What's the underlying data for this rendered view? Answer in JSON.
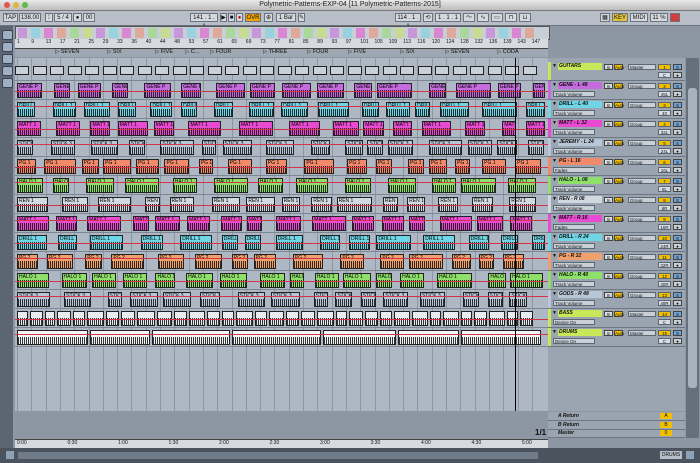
{
  "window": {
    "title": "Polymetric-Patterns-EXP-04  [11 Polymetric-Patterns-2015]"
  },
  "toolbar": {
    "tap": "TAP",
    "tempo": "138.00",
    "time_sig": "5 / 4",
    "metronome": "00",
    "position": "141 . 1 . 1",
    "ovr": "OVR",
    "quantize": "1 Bar",
    "loop_start": "114 . 1 . 1",
    "loop_length": "1 . 1 . 1",
    "key": "KEY",
    "midi": "MIDI",
    "cpu": "11 %"
  },
  "ruler": {
    "bars": [
      "1",
      "9",
      "13",
      "17",
      "21",
      "25",
      "29",
      "33",
      "36",
      "40",
      "44",
      "48",
      "53",
      "57",
      "61",
      "65",
      "69",
      "73",
      "77",
      "81",
      "85",
      "89",
      "93",
      "97",
      "101",
      "105",
      "109",
      "113",
      "116",
      "120",
      "124",
      "128",
      "132",
      "136",
      "139",
      "143",
      "147"
    ]
  },
  "locators": [
    "SEVEN",
    "SIX",
    "FIVE",
    "C...",
    "FOUR",
    "THREE",
    "FOUR",
    "FIVE",
    "SIX",
    "SEVEN",
    "CODA"
  ],
  "time_ruler": [
    "0:00",
    "0:30",
    "1:00",
    "1:30",
    "2:00",
    "2:30",
    "3:00",
    "3:30",
    "4:00",
    "4:30",
    "5:00"
  ],
  "pager": "1/1",
  "tracks": [
    {
      "name": "GUITARS",
      "sub": "",
      "color": "#c8e85a",
      "io": "Master",
      "n1": "1",
      "n2": "C"
    },
    {
      "name": "GENE - L 48",
      "sub": "Track Volume",
      "color": "#c66adf",
      "io": "Group",
      "n1": "2",
      "n2": "45L"
    },
    {
      "name": "DRILL - L 40",
      "sub": "Track Volume",
      "color": "#6fd6e6",
      "io": "Group",
      "n1": "3",
      "n2": "40"
    },
    {
      "name": "MATT - L 32",
      "sub": "Track Volume",
      "color": "#e84ad2",
      "io": "Group",
      "n1": "4",
      "n2": "32L"
    },
    {
      "name": "JEREMY - L 24",
      "sub": "Track Volume",
      "color": "#b7c7d8",
      "io": "Group",
      "n1": "5",
      "n2": "24L"
    },
    {
      "name": "PG - L 16",
      "sub": "Fades",
      "color": "#f08a6a",
      "io": "Group",
      "n1": "6",
      "n2": "16L"
    },
    {
      "name": "HALO - L 08",
      "sub": "Track Volume",
      "color": "#8ee06a",
      "io": "Group",
      "n1": "7",
      "n2": "8L"
    },
    {
      "name": "REN - R 08",
      "sub": "Track Volume",
      "color": "#d0d8e0",
      "io": "Group",
      "n1": "8",
      "n2": "8R"
    },
    {
      "name": "MATT - R 16",
      "sub": "Fades",
      "color": "#e84ad2",
      "io": "Group",
      "n1": "9",
      "n2": "16R"
    },
    {
      "name": "DRILL - R 24",
      "sub": "Track Volume",
      "color": "#6fd6e6",
      "io": "Group",
      "n1": "10",
      "n2": "24R"
    },
    {
      "name": "PG - R 32",
      "sub": "Track Volume",
      "color": "#f0a06a",
      "io": "Group",
      "n1": "11",
      "n2": "32R"
    },
    {
      "name": "HALO - R 40",
      "sub": "Track Volume",
      "color": "#8ee06a",
      "io": "Group",
      "n1": "12",
      "n2": "40R"
    },
    {
      "name": "GODS - R 48",
      "sub": "Track Volume",
      "color": "#b7c7d8",
      "io": "Group",
      "n1": "13",
      "n2": "48R"
    },
    {
      "name": "BASS",
      "sub": "Device On",
      "color": "#c8e85a",
      "io": "Master",
      "n1": "14",
      "n2": "C"
    },
    {
      "name": "DRUMS",
      "sub": "Device On",
      "color": "#c8e85a",
      "io": "Master",
      "n1": "15",
      "n2": "C"
    }
  ],
  "returns": [
    {
      "name": "A Return",
      "n": "A"
    },
    {
      "name": "B Return",
      "n": "B"
    },
    {
      "name": "Master",
      "n": "0"
    }
  ],
  "clip_labels": [
    "GENE P",
    "DRILL 1",
    "MATT 1",
    "STICK 3",
    "PG 1",
    "HALO 1",
    "REN 1",
    "MATT 1",
    "DRILL 1",
    "PG 2",
    "HALO 1",
    "STICK 3"
  ],
  "colors": {
    "accent": "#f0a400",
    "automation": "#d2344a",
    "arrange_bg": "#aeb8c4"
  }
}
